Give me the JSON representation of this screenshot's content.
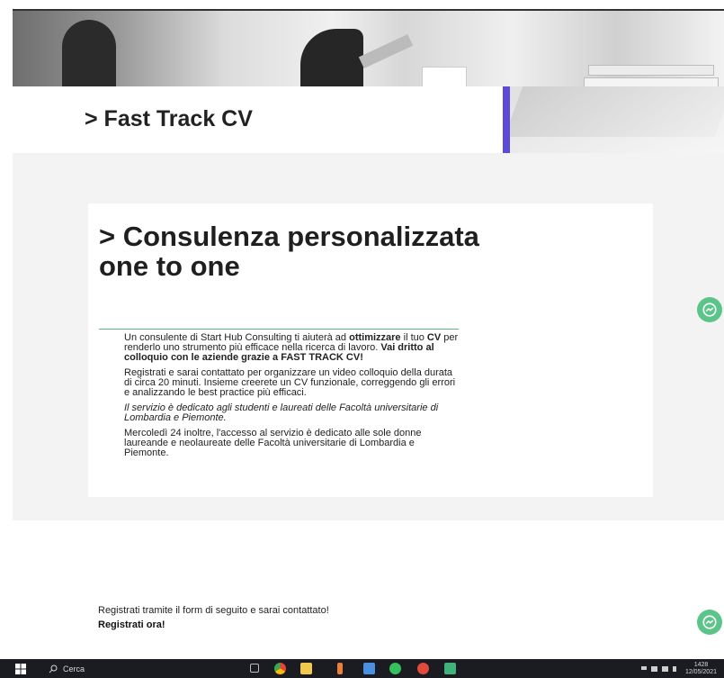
{
  "hero": {
    "title": "> Fast Track CV"
  },
  "card": {
    "title": "> Consulenza personalizzata one to one",
    "p1": {
      "a": "Un consulente di Start Hub Consulting ti aiuterà ad ",
      "b": "ottimizzare",
      "c": " il tuo ",
      "d": "CV",
      "e": " per renderlo uno strumento più efficace nella ricerca di lavoro. ",
      "f": "Vai dritto al colloquio con le aziende grazie a FAST TRACK CV!"
    },
    "p2": "Registrati e sarai contattato per organizzare un video colloquio della durata di circa 20 minuti. Insieme creerete un CV funzionale, correggendo gli errori e analizzando le best practice più efficaci.",
    "p3": "Il servizio è dedicato agli studenti e laureati delle Facoltà universitarie di Lombardia e Piemonte.",
    "p4": "Mercoledì 24 inoltre, l'accesso al servizio è dedicato alle sole donne laureande e neolaureate delle Facoltà universitarie di Lombardia e Piemonte."
  },
  "cta": {
    "text": "Registrati tramite il form di seguito e sarai contattato!",
    "link": "Registrati ora!"
  },
  "chat": {
    "icon": "messenger-icon",
    "color": "#5bc489"
  },
  "taskbar": {
    "search_placeholder": "Cerca",
    "time": "1428",
    "date": "12/05/2021",
    "apps": [
      "task-view",
      "chrome",
      "file-explorer",
      "app-yellow",
      "app-blue",
      "whatsapp",
      "app-red",
      "app-green"
    ]
  },
  "colors": {
    "accent": "#5b4bd8",
    "divider": "#5bbf7a",
    "section_bg": "#f3f3f3"
  }
}
